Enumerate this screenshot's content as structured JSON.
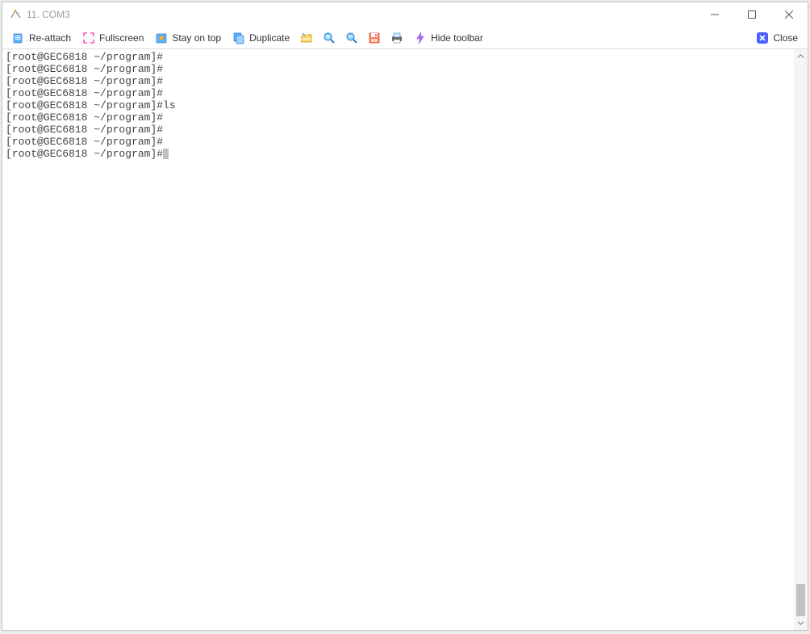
{
  "window": {
    "title": "11. COM3"
  },
  "toolbar": {
    "reattach": "Re-attach",
    "fullscreen": "Fullscreen",
    "stayontop": "Stay on top",
    "duplicate": "Duplicate",
    "hidetoolbar": "Hide toolbar",
    "close": "Close"
  },
  "terminal": {
    "lines": [
      "[root@GEC6818 ~/program]#",
      "[root@GEC6818 ~/program]#",
      "[root@GEC6818 ~/program]#",
      "[root@GEC6818 ~/program]#",
      "[root@GEC6818 ~/program]#ls",
      "[root@GEC6818 ~/program]#",
      "[root@GEC6818 ~/program]#",
      "[root@GEC6818 ~/program]#",
      "[root@GEC6818 ~/program]#"
    ]
  }
}
